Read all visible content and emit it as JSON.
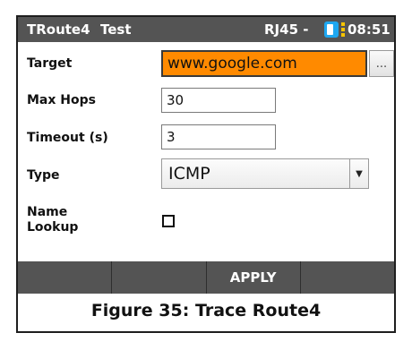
{
  "title_bar": {
    "app": "TRoute4",
    "mode": "Test",
    "port": "RJ45 -",
    "time": "08:51",
    "battery_icon": "battery-icon"
  },
  "form": {
    "target": {
      "label": "Target",
      "value": "www.google.com",
      "browse_label": "..."
    },
    "max_hops": {
      "label": "Max Hops",
      "value": "30"
    },
    "timeout": {
      "label": "Timeout (s)",
      "value": "3"
    },
    "type": {
      "label": "Type",
      "value": "ICMP"
    },
    "name_lookup": {
      "label_line1": "Name",
      "label_line2": "Lookup",
      "checked": false
    }
  },
  "softkeys": [
    "",
    "",
    "APPLY",
    ""
  ],
  "caption": "Figure 35: Trace Route4",
  "colors": {
    "titlebar_bg": "#545454",
    "focus_field": "#ff8a00",
    "battery": "#1ea7f0",
    "battery_dots": "#f6c400"
  }
}
